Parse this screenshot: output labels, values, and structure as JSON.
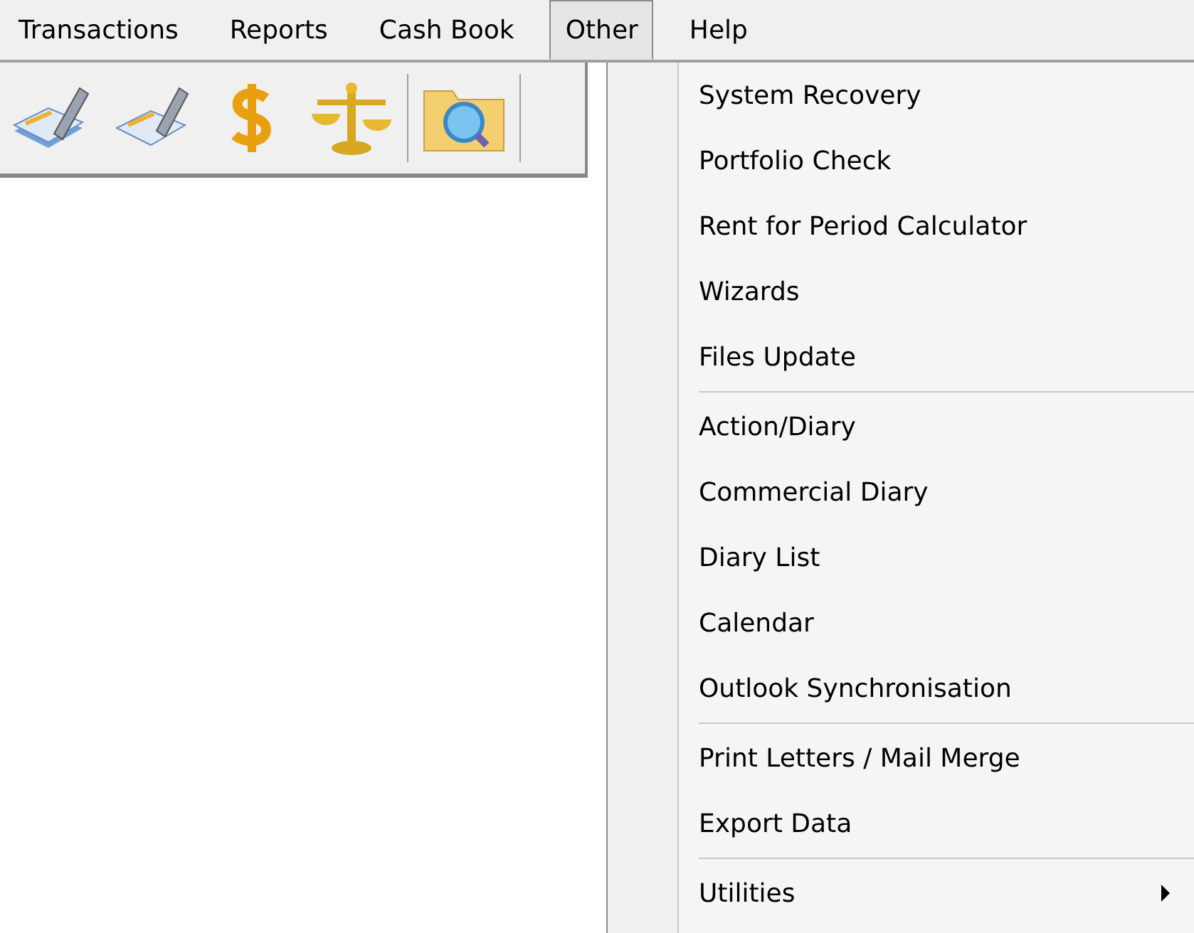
{
  "menu_bar": {
    "items": [
      {
        "label": "Transactions",
        "selected": false
      },
      {
        "label": "Reports",
        "selected": false
      },
      {
        "label": "Cash Book",
        "selected": false
      },
      {
        "label": "Other",
        "selected": true
      },
      {
        "label": "Help",
        "selected": false
      }
    ]
  },
  "dropdown": {
    "items": [
      {
        "kind": "item",
        "label": "System Recovery"
      },
      {
        "kind": "item",
        "label": "Portfolio Check"
      },
      {
        "kind": "item",
        "label": "Rent for Period Calculator"
      },
      {
        "kind": "item",
        "label": "Wizards"
      },
      {
        "kind": "item",
        "label": "Files Update"
      },
      {
        "kind": "separator"
      },
      {
        "kind": "item",
        "label": "Action/Diary"
      },
      {
        "kind": "item",
        "label": "Commercial Diary"
      },
      {
        "kind": "item",
        "label": "Diary List"
      },
      {
        "kind": "item",
        "label": "Calendar"
      },
      {
        "kind": "item",
        "label": "Outlook Synchronisation"
      },
      {
        "kind": "separator"
      },
      {
        "kind": "item",
        "label": "Print Letters / Mail Merge"
      },
      {
        "kind": "item",
        "label": "Export Data"
      },
      {
        "kind": "separator"
      },
      {
        "kind": "item",
        "label": "Utilities",
        "submenu": true
      }
    ]
  }
}
